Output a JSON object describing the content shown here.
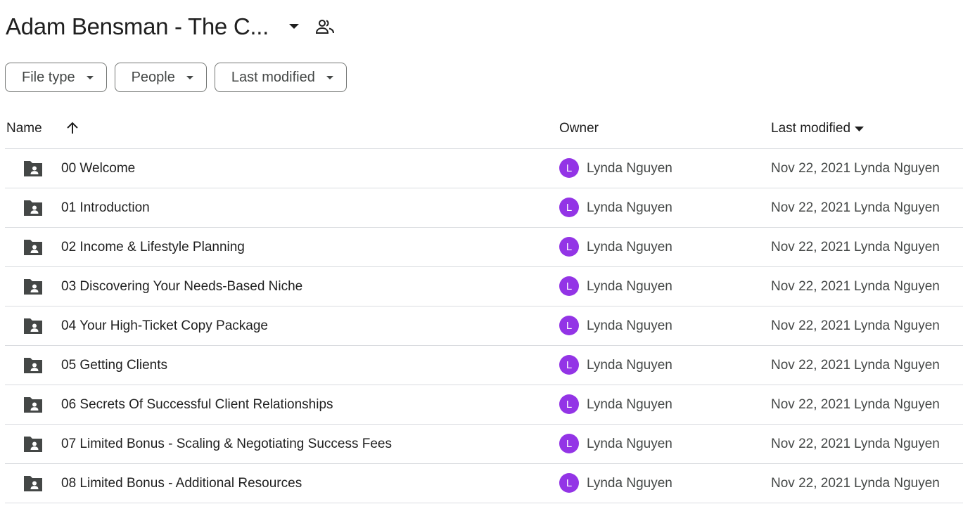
{
  "header": {
    "title": "Adam Bensman - The C...",
    "caret_icon": "arrow-drop-down-icon",
    "shared_icon": "people-icon"
  },
  "filters": [
    {
      "label": "File type"
    },
    {
      "label": "People"
    },
    {
      "label": "Last modified"
    }
  ],
  "columns": {
    "name": "Name",
    "owner": "Owner",
    "last_modified": "Last modified"
  },
  "colors": {
    "avatar": "#9334e6",
    "folder": "#444746",
    "divider": "#dadce0"
  },
  "rows": [
    {
      "name": "00 Welcome",
      "owner_initial": "L",
      "owner": "Lynda Nguyen",
      "modified_date": "Nov 22, 2021",
      "modified_by": "Lynda Nguyen"
    },
    {
      "name": "01 Introduction",
      "owner_initial": "L",
      "owner": "Lynda Nguyen",
      "modified_date": "Nov 22, 2021",
      "modified_by": "Lynda Nguyen"
    },
    {
      "name": "02 Income & Lifestyle Planning",
      "owner_initial": "L",
      "owner": "Lynda Nguyen",
      "modified_date": "Nov 22, 2021",
      "modified_by": "Lynda Nguyen"
    },
    {
      "name": "03 Discovering Your Needs-Based Niche",
      "owner_initial": "L",
      "owner": "Lynda Nguyen",
      "modified_date": "Nov 22, 2021",
      "modified_by": "Lynda Nguyen"
    },
    {
      "name": "04 Your High-Ticket Copy Package",
      "owner_initial": "L",
      "owner": "Lynda Nguyen",
      "modified_date": "Nov 22, 2021",
      "modified_by": "Lynda Nguyen"
    },
    {
      "name": "05 Getting Clients",
      "owner_initial": "L",
      "owner": "Lynda Nguyen",
      "modified_date": "Nov 22, 2021",
      "modified_by": "Lynda Nguyen"
    },
    {
      "name": "06 Secrets Of Successful Client Relationships",
      "owner_initial": "L",
      "owner": "Lynda Nguyen",
      "modified_date": "Nov 22, 2021",
      "modified_by": "Lynda Nguyen"
    },
    {
      "name": "07 Limited Bonus - Scaling & Negotiating Success Fees",
      "owner_initial": "L",
      "owner": "Lynda Nguyen",
      "modified_date": "Nov 22, 2021",
      "modified_by": "Lynda Nguyen"
    },
    {
      "name": "08 Limited Bonus - Additional Resources",
      "owner_initial": "L",
      "owner": "Lynda Nguyen",
      "modified_date": "Nov 22, 2021",
      "modified_by": "Lynda Nguyen"
    }
  ]
}
